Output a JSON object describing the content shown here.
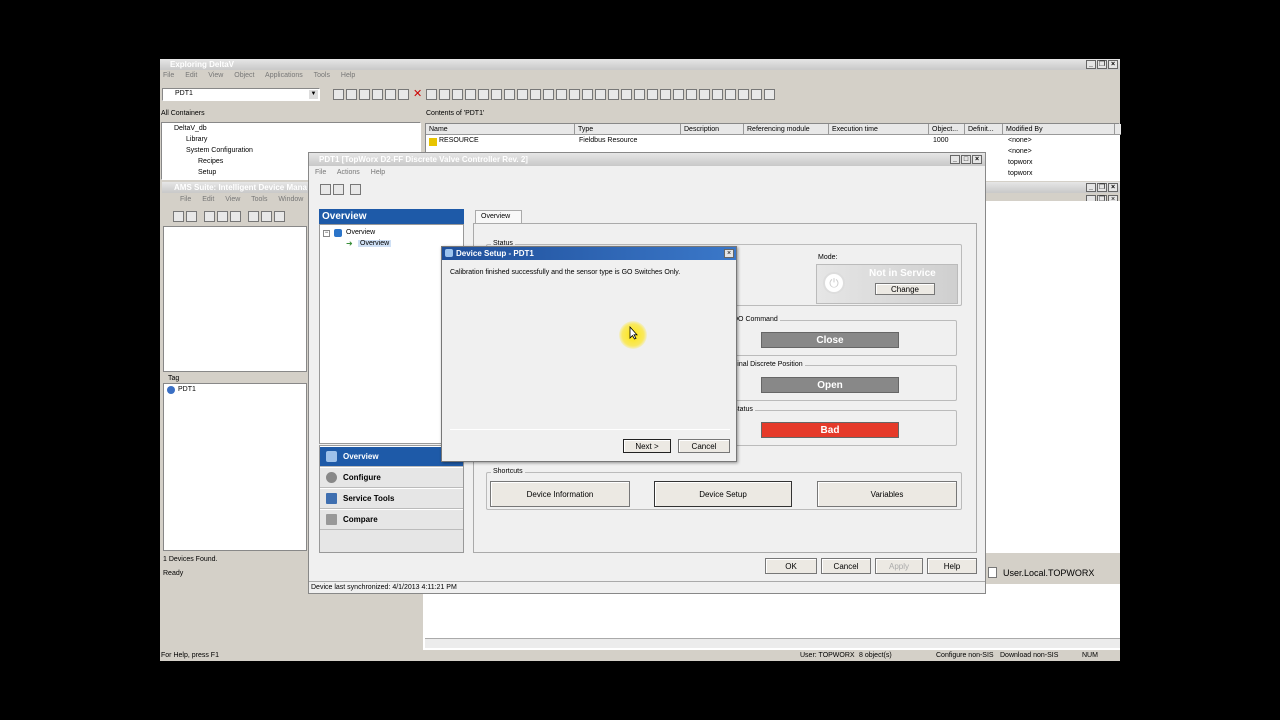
{
  "explorer": {
    "title": "Exploring DeltaV",
    "menu": [
      "File",
      "Edit",
      "View",
      "Object",
      "Applications",
      "Tools",
      "Help"
    ],
    "combo_value": "PDT1",
    "all_containers_label": "All Containers",
    "contents_label": "Contents of 'PDT1'",
    "tree": [
      "DeltaV_db",
      "Library",
      "System Configuration",
      "Recipes",
      "Setup"
    ],
    "columns": [
      "Name",
      "Type",
      "Description",
      "Referencing module",
      "Execution time",
      "Object...",
      "Definit...",
      "Modified By"
    ],
    "rows": [
      {
        "name": "RESOURCE",
        "type": "Fieldbus Resource",
        "object": "1000",
        "modified": "<none>"
      },
      {
        "name": "",
        "type": "",
        "object": "",
        "modified": "<none>"
      },
      {
        "name": "",
        "type": "",
        "object": "",
        "modified": "topworx"
      },
      {
        "name": "",
        "type": "",
        "object": "",
        "modified": "topworx"
      }
    ],
    "status_left": "For Help, press F1",
    "status_user": "User: TOPWORX",
    "status_objects": "8 object(s)",
    "status_config": "Configure non-SIS",
    "status_download": "Download non-SIS",
    "status_num": "NUM"
  },
  "ams": {
    "title": "AMS Suite: Intelligent Device Mana",
    "menu": [
      "File",
      "Edit",
      "View",
      "Tools",
      "Window",
      "He"
    ],
    "tag_label": "Tag",
    "tag_item": "PDT1",
    "devices_found": "1 Devices Found.",
    "ready": "Ready",
    "user_local": "User.Local.TOPWORX"
  },
  "device_window": {
    "title": "PDT1 [TopWorx D2-FF Discrete Valve Controller Rev. 2]",
    "menu": [
      "File",
      "Actions",
      "Help"
    ],
    "overview_header": "Overview",
    "tree_root": "Overview",
    "tree_child": "Overview",
    "tab": "Overview",
    "status_group": "Status",
    "mode_label": "Mode:",
    "mode_value": "Not in Service",
    "change_button": "Change",
    "do_command_label": "DO Command",
    "do_command_value": "Close",
    "final_pos_label": "Final Discrete Position",
    "final_pos_value": "Open",
    "status_label": "Status",
    "status_value": "Bad",
    "shortcuts_label": "Shortcuts",
    "shortcut_buttons": [
      "Device Information",
      "Device Setup",
      "Variables"
    ],
    "nav": [
      "Overview",
      "Configure",
      "Service Tools",
      "Compare"
    ],
    "ok": "OK",
    "cancel": "Cancel",
    "apply": "Apply",
    "help": "Help",
    "last_sync": "Device last synchronized: 4/1/2013 4:11:21 PM"
  },
  "dialog": {
    "title": "Device Setup - PDT1",
    "message": "Calibration finished successfully and the sensor type is GO Switches Only.",
    "next": "Next >",
    "cancel": "Cancel"
  },
  "colors": {
    "overview_blue": "#1e5aa8",
    "bad_red": "#e53a2a",
    "pill_gray": "#888888",
    "cursor_highlight": "#ffe400"
  }
}
